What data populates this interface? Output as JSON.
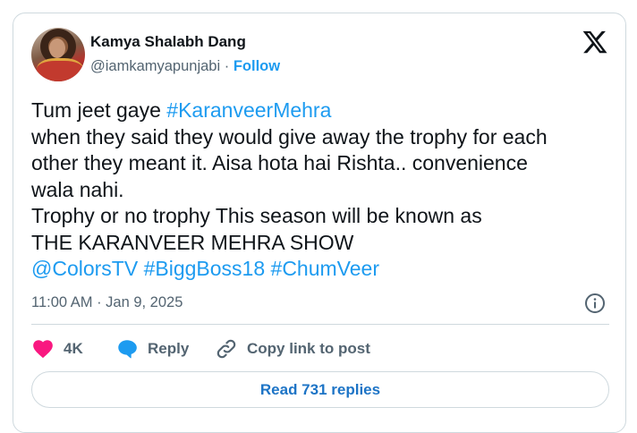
{
  "author": {
    "name": "Kamya Shalabh Dang",
    "handle": "@iamkamyapunjabi",
    "separator": " · ",
    "follow_label": "Follow"
  },
  "tweet": {
    "lines": [
      [
        {
          "t": "Tum jeet gaye "
        },
        {
          "t": "#KaranveerMehra",
          "link": true
        }
      ],
      [
        {
          "t": "when they said they would give away the trophy for each"
        }
      ],
      [
        {
          "t": "other they meant it. Aisa hota hai Rishta.. convenience"
        }
      ],
      [
        {
          "t": "wala nahi."
        }
      ],
      [
        {
          "t": "Trophy or no trophy This season will be known as"
        }
      ],
      [
        {
          "t": "THE KARANVEER MEHRA SHOW"
        }
      ],
      [
        {
          "t": "@ColorsTV",
          "link": true
        },
        {
          "t": " "
        },
        {
          "t": "#BiggBoss18",
          "link": true
        },
        {
          "t": " "
        },
        {
          "t": "#ChumVeer",
          "link": true
        }
      ]
    ]
  },
  "meta": {
    "timestamp": "11:00 AM · Jan 9, 2025"
  },
  "actions": {
    "like_count": "4K",
    "reply_label": "Reply",
    "copy_label": "Copy link to post"
  },
  "read_replies_label": "Read 731 replies",
  "colors": {
    "accent": "#1d9bf0",
    "like": "#f91880",
    "text": "#0f1419",
    "muted": "#536471",
    "border": "#cfd9de"
  },
  "icons": [
    "x-logo-icon",
    "info-icon",
    "heart-icon",
    "reply-bubble-icon",
    "link-icon"
  ]
}
